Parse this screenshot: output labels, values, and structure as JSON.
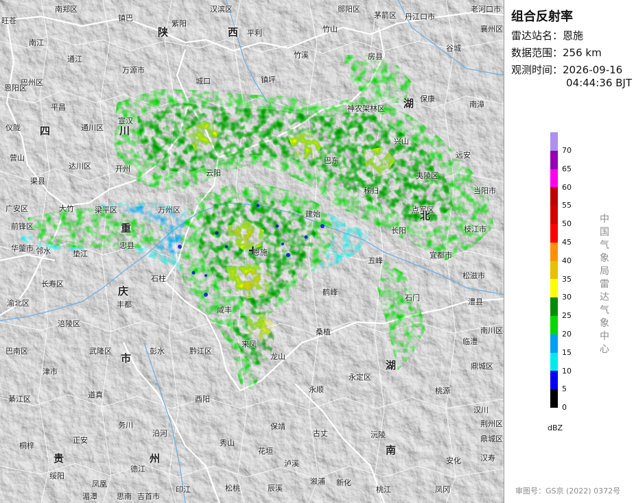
{
  "panel": {
    "title": "组合反射率",
    "station_label": "雷达站名：",
    "station": "恩施",
    "range_label": "数据范围：",
    "range": "256 km",
    "time_label": "观测时间：",
    "time_date": "2026-09-16",
    "time_clock": "04:44:36 BJT",
    "vertical_text": "中国气象局雷达气象中心",
    "approval": "审图号：GS京 (2022) 0372号"
  },
  "legend": {
    "unit": "dBZ",
    "ticks": [
      "70",
      "65",
      "60",
      "55",
      "50",
      "45",
      "40",
      "35",
      "30",
      "25",
      "20",
      "15",
      "10",
      "5",
      "0"
    ],
    "colors": [
      "#ad90f0",
      "#9600b4",
      "#ff00f0",
      "#c00000",
      "#d60000",
      "#ff0000",
      "#ff9000",
      "#e7c000",
      "#ffff00",
      "#008e00",
      "#00d800",
      "#01a0f6",
      "#00ecec",
      "#0000f6",
      "#000000"
    ]
  },
  "map": {
    "radar_marker": "+",
    "provinces": [
      "陕",
      "西",
      "四",
      "川",
      "重",
      "庆",
      "市",
      "湖",
      "北",
      "湖",
      "南",
      "贵",
      "州"
    ],
    "places": [
      "南郑区",
      "镇巴",
      "汉滨区",
      "郧阳区",
      "丹江口市",
      "老河口市",
      "襄州区",
      "旺苍",
      "紫阳",
      "竹山",
      "茅箭区",
      "南江",
      "通江",
      "平利",
      "竹溪",
      "谷城",
      "房县",
      "巴州区",
      "万源市",
      "城口",
      "镇坪",
      "保康",
      "南漳",
      "恩阳区",
      "平昌",
      "宣汉",
      "神农架林区",
      "仪陇",
      "通川区",
      "开州",
      "兴山",
      "远安",
      "营山",
      "达川区",
      "渠县",
      "云阳",
      "巴东",
      "秭归",
      "夷陵区",
      "当阳市",
      "广安区",
      "大竹",
      "梁平区",
      "万州区",
      "建始",
      "长阳",
      "点军区",
      "枝江市",
      "前锋区",
      "邻水",
      "忠县",
      "恩施",
      "五峰",
      "宜都市",
      "华蓥市",
      "垫江",
      "石柱",
      "长寿区",
      "丰都",
      "咸丰",
      "鹤峰",
      "石门",
      "松滋市",
      "渝北区",
      "澧县",
      "涪陵区",
      "来凤",
      "桑植",
      "临澧",
      "巴南区",
      "武隆区",
      "彭水",
      "黔江区",
      "龙山",
      "永定区",
      "鼎城区",
      "南川区",
      "津市",
      "綦江区",
      "道真",
      "酉阳",
      "永顺",
      "桃源",
      "务川",
      "沿河",
      "保靖",
      "古丈",
      "沅陵",
      "桐梓",
      "正安",
      "秀山",
      "花垣",
      "安化",
      "绥阳",
      "德江",
      "印江",
      "松桃",
      "凤凰",
      "辰溪",
      "新化",
      "凤冈",
      "湄潭",
      "思南",
      "吉首市",
      "泸溪",
      "溆浦",
      "桃江",
      "鼎城区",
      "汉寿",
      "汉川",
      "荆州区"
    ]
  }
}
